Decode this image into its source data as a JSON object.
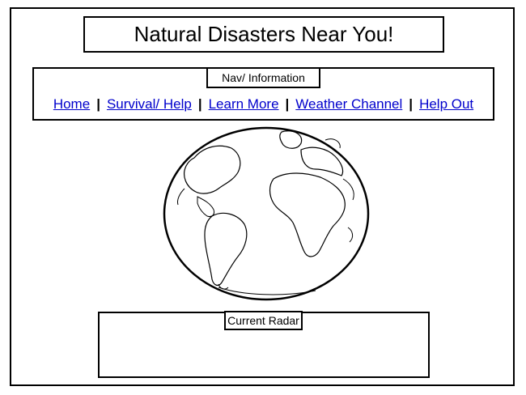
{
  "header": {
    "title": "Natural Disasters Near You!"
  },
  "nav": {
    "heading": "Nav/ Information",
    "links": [
      "Home",
      "Survival/ Help",
      "Learn More",
      "Weather Channel",
      "Help Out"
    ],
    "separator": "|"
  },
  "radar": {
    "heading": "Current Radar"
  },
  "globe": {
    "icon": "globe-icon"
  }
}
